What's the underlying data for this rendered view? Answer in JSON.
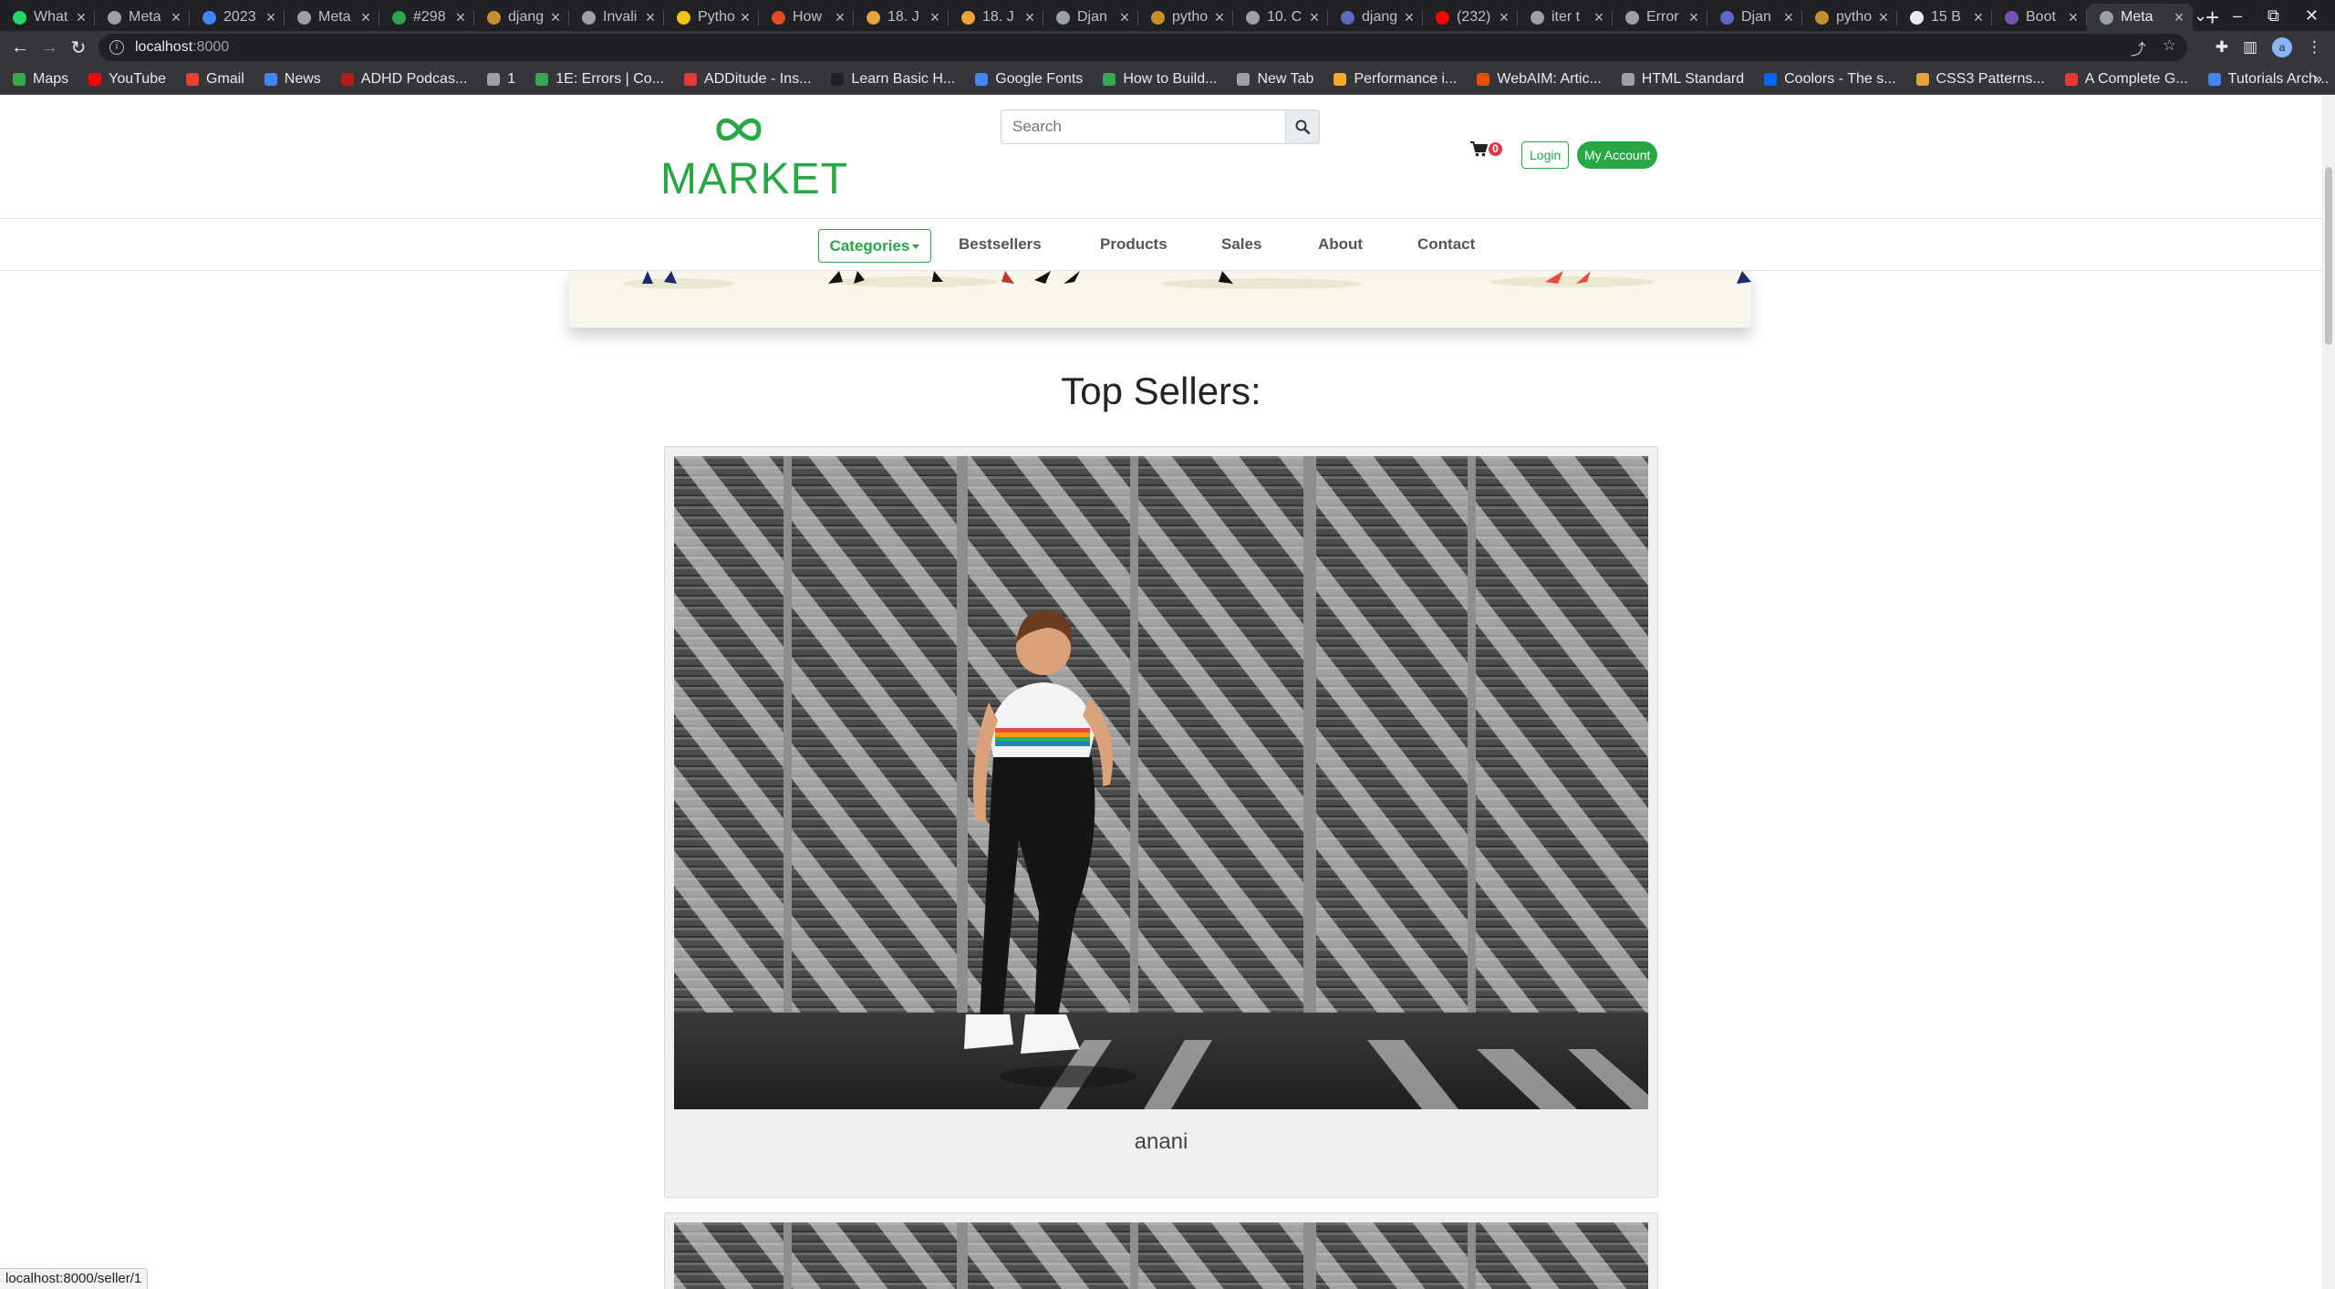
{
  "browser": {
    "tabs": [
      {
        "title": "What",
        "color": "#25d366"
      },
      {
        "title": "Meta",
        "color": "#9aa0a6"
      },
      {
        "title": "2023",
        "color": "#4285f4"
      },
      {
        "title": "Meta",
        "color": "#9aa0a6"
      },
      {
        "title": "#298",
        "color": "#2ea44f"
      },
      {
        "title": "djang",
        "color": "#c58f2b"
      },
      {
        "title": "Invali",
        "color": "#9aa0a6"
      },
      {
        "title": "Pytho",
        "color": "#f0c419"
      },
      {
        "title": "How",
        "color": "#e34c26"
      },
      {
        "title": "18. J",
        "color": "#e8a33d"
      },
      {
        "title": "18. J",
        "color": "#e8a33d"
      },
      {
        "title": "Djan",
        "color": "#9aa0a6"
      },
      {
        "title": "pytho",
        "color": "#c58f2b"
      },
      {
        "title": "10. C",
        "color": "#9aa0a6"
      },
      {
        "title": "djang",
        "color": "#5c6bc0"
      },
      {
        "title": "(232)",
        "color": "#ff0000"
      },
      {
        "title": "iter t",
        "color": "#9aa0a6"
      },
      {
        "title": "Error",
        "color": "#9aa0a6"
      },
      {
        "title": "Djan",
        "color": "#5c6bc0"
      },
      {
        "title": "pytho",
        "color": "#c58f2b"
      },
      {
        "title": "15 B",
        "color": "#e8eaed"
      },
      {
        "title": "Boot",
        "color": "#7952b3"
      }
    ],
    "active_tab": {
      "title": "Meta",
      "color": "#9aa0a6"
    },
    "new_tab": "+",
    "url_host": "localhost",
    "url_port": ":8000",
    "bookmarks": [
      {
        "label": "Maps",
        "color": "#34a853"
      },
      {
        "label": "YouTube",
        "color": "#ff0000"
      },
      {
        "label": "Gmail",
        "color": "#ea4335"
      },
      {
        "label": "News",
        "color": "#4285f4"
      },
      {
        "label": "ADHD Podcas...",
        "color": "#b71c1c"
      },
      {
        "label": "1",
        "color": "#9aa0a6"
      },
      {
        "label": "1E: Errors | Co...",
        "color": "#34a853"
      },
      {
        "label": "ADDitude - Ins...",
        "color": "#e53935"
      },
      {
        "label": "Learn Basic H...",
        "color": "#202124"
      },
      {
        "label": "Google Fonts",
        "color": "#4285f4"
      },
      {
        "label": "How to Build...",
        "color": "#34a853"
      },
      {
        "label": "New Tab",
        "color": "#9aa0a6"
      },
      {
        "label": "Performance i...",
        "color": "#f9a825"
      },
      {
        "label": "WebAIM: Artic...",
        "color": "#e65100"
      },
      {
        "label": "HTML Standard",
        "color": "#9aa0a6"
      },
      {
        "label": "Coolors - The s...",
        "color": "#0066ff"
      },
      {
        "label": "CSS3 Patterns...",
        "color": "#e8a33d"
      },
      {
        "label": "A Complete G...",
        "color": "#e53935"
      },
      {
        "label": "Tutorials Arch...",
        "color": "#4285f4"
      }
    ],
    "bookmarks_more": "»",
    "profile_initial": "a",
    "status_url": "localhost:8000/seller/1"
  },
  "site": {
    "logo_text": "MARKET",
    "brand_color": "#28a745",
    "search_placeholder": "Search",
    "cart_count": "0",
    "login_label": "Login",
    "account_label": "My Account",
    "categories_label": "Categories",
    "nav": [
      "Bestsellers",
      "Products",
      "Sales",
      "About",
      "Contact"
    ]
  },
  "main": {
    "section_title": "Top Sellers:",
    "sellers": [
      {
        "name": "anani"
      }
    ]
  }
}
